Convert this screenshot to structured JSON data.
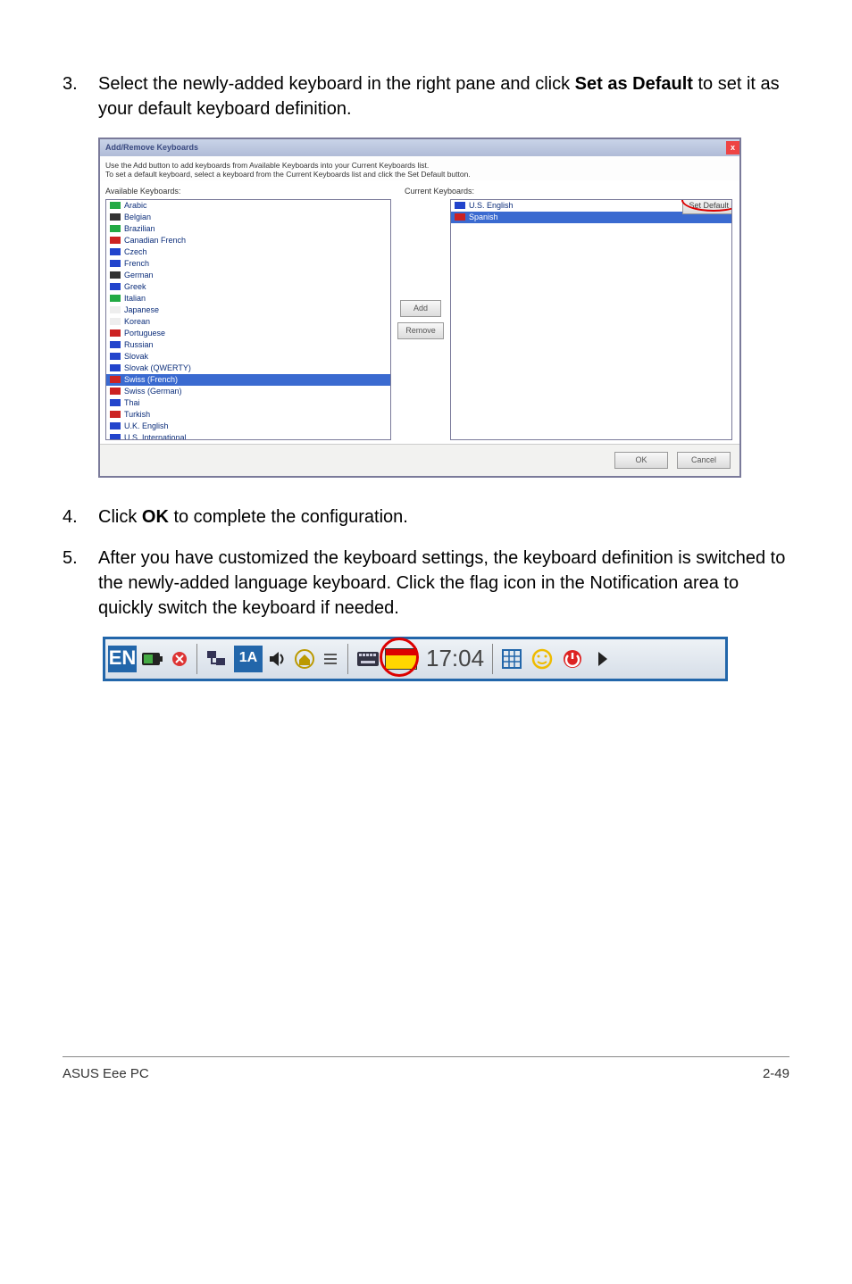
{
  "steps": {
    "s3": {
      "num": "3.",
      "pre": "Select the newly-added keyboard in the right pane and click ",
      "bold": "Set as Default",
      "post": " to set it as your default keyboard definition."
    },
    "s4": {
      "num": "4.",
      "pre": "Click ",
      "bold": "OK",
      "post": " to complete the configuration."
    },
    "s5": {
      "num": "5.",
      "text": "After you have customized the keyboard settings, the keyboard definition is switched to the newly-added language keyboard. Click the flag icon in the Notification area to quickly switch the keyboard if needed."
    }
  },
  "dialog": {
    "title": "Add/Remove Keyboards",
    "close": "x",
    "instr": "Use the Add button to add keyboards from Available Keyboards into your Current Keyboards list.\nTo set a default keyboard, select a keyboard from the Current Keyboards list and click the Set Default button.",
    "available_label": "Available Keyboards:",
    "current_label": "Current Keyboards:",
    "available": [
      "Arabic",
      "Belgian",
      "Brazilian",
      "Canadian French",
      "Czech",
      "French",
      "German",
      "Greek",
      "Italian",
      "Japanese",
      "Korean",
      "Portuguese",
      "Russian",
      "Slovak",
      "Slovak (QWERTY)",
      "Swiss (French)",
      "Swiss (German)",
      "Thai",
      "Turkish",
      "U.K. English",
      "U.S. International"
    ],
    "available_selected_index": 15,
    "current": [
      "U.S. English",
      "Spanish"
    ],
    "current_selected_index": 1,
    "add_btn": "Add",
    "remove_btn": "Remove",
    "setdefault_btn": "Set Default",
    "ok_btn": "OK",
    "cancel_btn": "Cancel"
  },
  "taskbar": {
    "lang": "EN",
    "clock": "17:04"
  },
  "footer": {
    "left": "ASUS Eee PC",
    "right": "2-49"
  }
}
